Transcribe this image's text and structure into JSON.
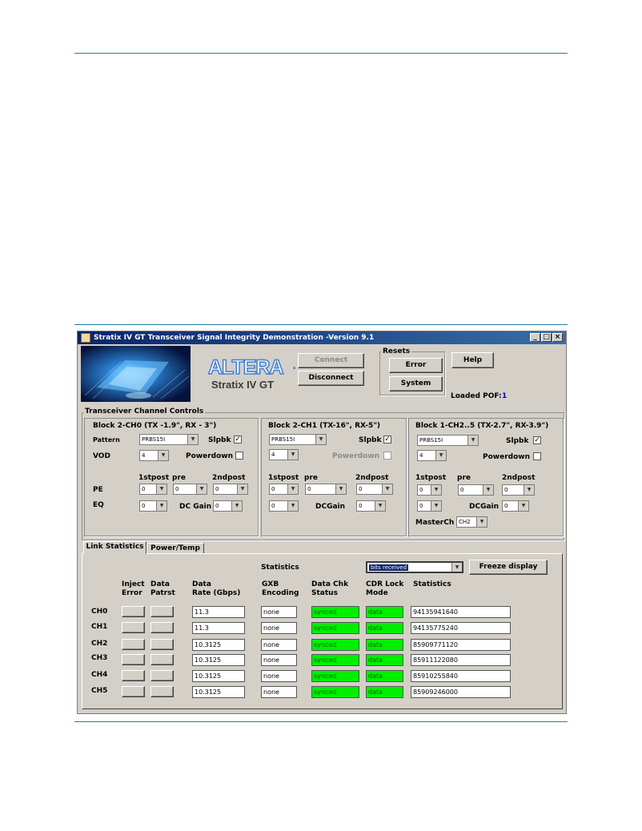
{
  "window": {
    "title": "Stratix IV GT Transceiver Signal Integrity Demonstration -Version 9.1",
    "min_label": "_",
    "max_label": "□",
    "close_label": "×"
  },
  "header": {
    "brand": "ALTERA",
    "brand_mark": ".",
    "product": "Stratix IV GT",
    "connect_label": "Connect",
    "disconnect_label": "Disconnect",
    "resets_label": "Resets",
    "error_label": "Error",
    "system_label": "System",
    "help_label": "Help",
    "loaded_pof_label": "Loaded POF:",
    "loaded_pof_value": "1"
  },
  "controls": {
    "title": "Transceiver Channel Controls",
    "block1": {
      "title": "Block 2-CH0 (TX -1.9\", RX - 3\")",
      "pattern_label": "Pattern",
      "pattern_value": "PRBS15I",
      "slpbk_label": "Slpbk",
      "slpbk_check": "✓",
      "vod_label": "VOD",
      "vod_value": "4",
      "powerdown_label": "Powerdown",
      "powerdown_check": "",
      "h_1stpost": "1stpost",
      "h_pre": "pre",
      "h_2ndpost": "2ndpost",
      "pe_label": "PE",
      "pe1": "0",
      "pe2": "0",
      "pe3": "0",
      "eq_label": "EQ",
      "eq_value": "0",
      "dcgain_label": "DC Gain",
      "dcgain_value": "0"
    },
    "block2": {
      "title": "Block 2-CH1 (TX-16\", RX-5\")",
      "pattern_value": "PRBS15I",
      "slpbk_label": "Slpbk",
      "slpbk_check": "✓",
      "vod_value": "4",
      "powerdown_label": "Powerdown",
      "powerdown_check": "",
      "h_1stpost": "1stpost",
      "h_pre": "pre",
      "h_2ndpost": "2ndpost",
      "pe1": "0",
      "pe2": "0",
      "pe3": "0",
      "eq_value": "0",
      "dcgain_label": "DCGain",
      "dcgain_value": "0"
    },
    "block3": {
      "title": "Block 1-CH2..5 (TX-2.7\", RX-3.9\")",
      "pattern_value": "PRBS15I",
      "slpbk_label": "Slpbk",
      "slpbk_check": "✓",
      "vod_value": "4",
      "powerdown_label": "Powerdown",
      "powerdown_check": "",
      "h_1stpost": "1stpost",
      "h_pre": "pre",
      "h_2ndpost": "2ndpost",
      "pe1": "0",
      "pe2": "0",
      "pe3": "0",
      "eq_value": "0",
      "dcgain_label": "DCGain",
      "dcgain_value": "0",
      "masterch_label": "MasterCh",
      "masterch_value": "CH2"
    }
  },
  "tabs": {
    "link_statistics": "Link Statistics",
    "power_temp": "Power/Temp"
  },
  "stats": {
    "statistics_label": "Statistics",
    "stat_select": "bits received",
    "freeze_label": "Freeze display",
    "h_inject": "Inject",
    "h_error": "Error",
    "h_data1": "Data",
    "h_patrst": "Patrst",
    "h_data2": "Data",
    "h_rate": "Rate (Gbps)",
    "h_gxb": "GXB",
    "h_encoding": "Encoding",
    "h_datachk": "Data Chk",
    "h_status": "Status",
    "h_cdr": "CDR Lock",
    "h_mode": "Mode",
    "h_statistics": "Statistics"
  },
  "rows": [
    {
      "ch": "CH0",
      "rate": "11.3",
      "encoding": "none",
      "status": "synced",
      "mode": "data",
      "statistics": "94135941640"
    },
    {
      "ch": "CH1",
      "rate": "11.3",
      "encoding": "none",
      "status": "synced",
      "mode": "data",
      "statistics": "94135775240"
    },
    {
      "ch": "CH2",
      "rate": "10.3125",
      "encoding": "none",
      "status": "synced",
      "mode": "data",
      "statistics": "85909771120"
    },
    {
      "ch": "CH3",
      "rate": "10.3125",
      "encoding": "none",
      "status": "synced",
      "mode": "data",
      "statistics": "85911122080"
    },
    {
      "ch": "CH4",
      "rate": "10.3125",
      "encoding": "none",
      "status": "synced",
      "mode": "data",
      "statistics": "85910255840"
    },
    {
      "ch": "CH5",
      "rate": "10.3125",
      "encoding": "none",
      "status": "synced",
      "mode": "data",
      "statistics": "85909246000"
    }
  ],
  "colors": {
    "window_bg": "#d4d0c8",
    "titlebar": "#0a246a",
    "status_green": "#00f000",
    "brand_blue": "#3f7fd0",
    "pof_blue": "#0000cc"
  },
  "icons": {
    "window_icon": "java-cup-icon",
    "dropdown": "chevron-down-icon"
  }
}
